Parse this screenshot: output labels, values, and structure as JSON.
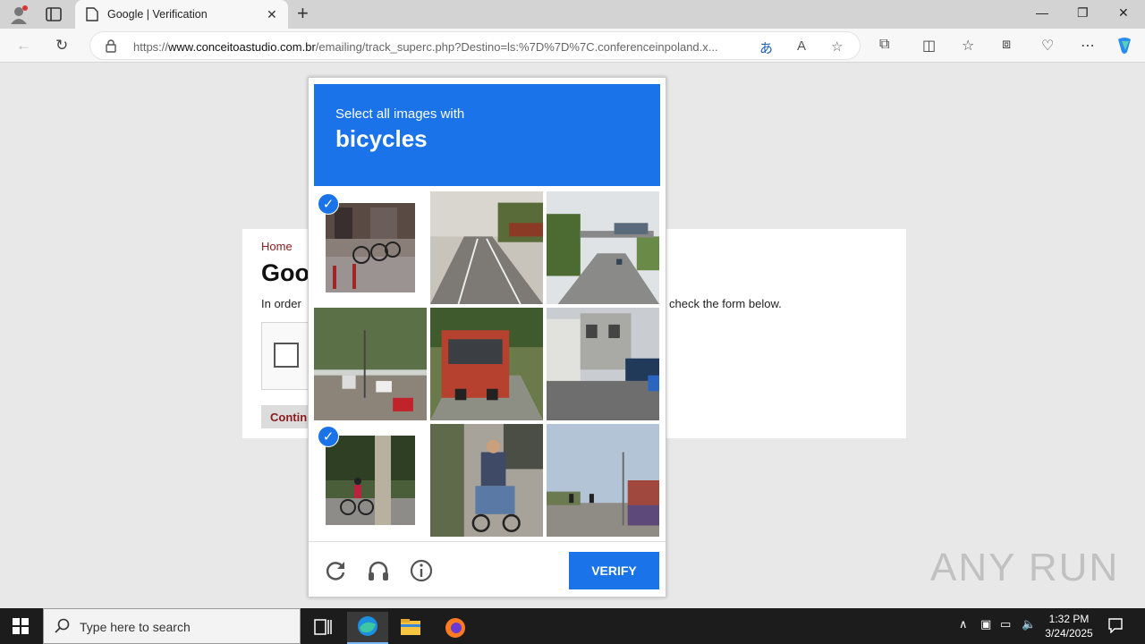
{
  "browser": {
    "tab_title": "Google | Verification",
    "url_prefix": "https://",
    "url_domain": "www.conceitoastudio.com.br",
    "url_path": "/emailing/track_superc.php?Destino=ls:%7D%7D%7C.conferenceinpoland.x..."
  },
  "page": {
    "home_link": "Home",
    "heading": "Goo",
    "desc_left": "In order",
    "desc_right": "check the form below.",
    "continue_label": "Contin"
  },
  "captcha": {
    "instruction": "Select all images with",
    "target": "bicycles",
    "verify_label": "VERIFY",
    "tiles": [
      {
        "scene": "bike-rack",
        "selected": true
      },
      {
        "scene": "highway",
        "selected": false
      },
      {
        "scene": "overpass-road",
        "selected": false
      },
      {
        "scene": "street-trees",
        "selected": false
      },
      {
        "scene": "red-truck",
        "selected": false
      },
      {
        "scene": "houses-cars",
        "selected": false
      },
      {
        "scene": "cyclist",
        "selected": true
      },
      {
        "scene": "tricycle",
        "selected": false
      },
      {
        "scene": "traffic-lights",
        "selected": false
      }
    ],
    "accent": "#1a73e8"
  },
  "watermark": "ANY RUN",
  "taskbar": {
    "search_placeholder": "Type here to search",
    "time": "1:32 PM",
    "date": "3/24/2025"
  }
}
